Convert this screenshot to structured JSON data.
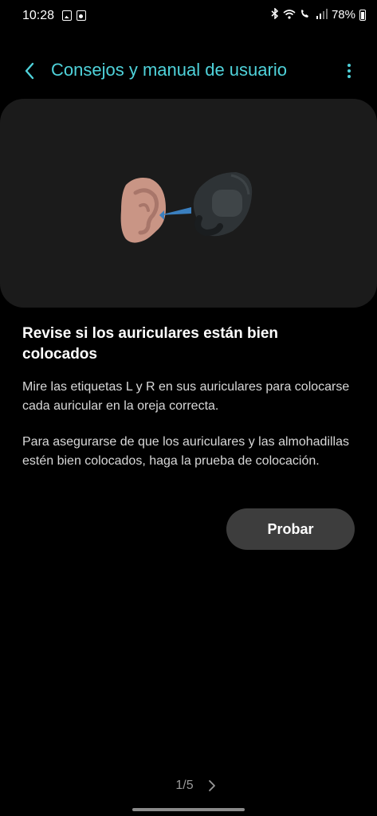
{
  "status_bar": {
    "time": "10:28",
    "battery_percent": "78%",
    "icons": [
      "gallery-icon",
      "speaker-icon",
      "bluetooth-icon",
      "wifi-icon",
      "volte-icon",
      "signal-icon",
      "battery-icon"
    ]
  },
  "header": {
    "title": "Consejos y manual de usuario",
    "back_icon": "chevron-left-icon",
    "more_icon": "more-vertical-icon",
    "accent_color": "#4fd2da"
  },
  "illustration": {
    "subject": "ear-and-earbud",
    "colors": {
      "ear": "#c99585",
      "earbud": "#2e3336",
      "arrow": "#3a7fbf"
    }
  },
  "content": {
    "title": "Revise si los auriculares están bien colocados",
    "paragraph1": "Mire las etiquetas L y R en sus auriculares para colocarse cada auricular en la oreja correcta.",
    "paragraph2": "Para asegurarse de que los auriculares y las almohadillas estén bien colocados, haga la prueba de colocación.",
    "button_label": "Probar"
  },
  "pager": {
    "label": "1/5",
    "next_icon": "chevron-right-icon"
  }
}
